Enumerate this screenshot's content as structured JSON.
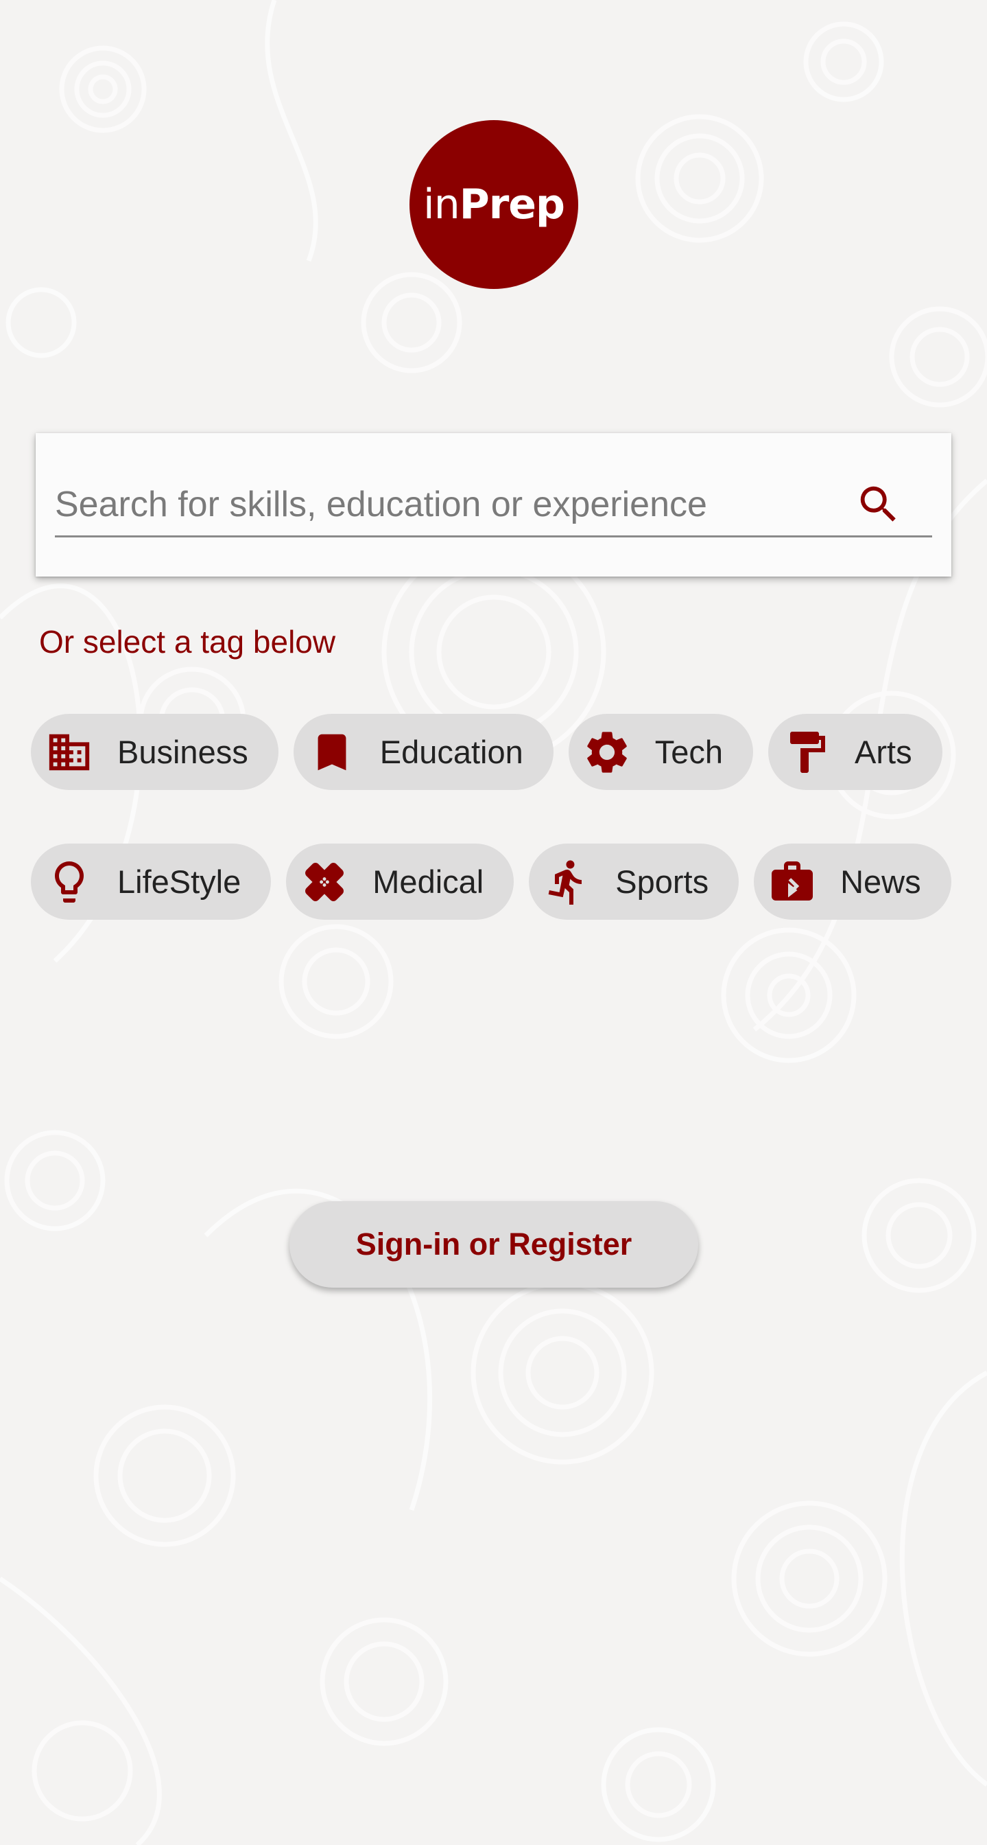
{
  "brand": {
    "logo_text_light": "in",
    "logo_text_bold": "Prep",
    "color": "#8b0000"
  },
  "search": {
    "placeholder": "Search for skills, education or experience",
    "value": "",
    "icon": "search-icon"
  },
  "tag_hint": "Or select a tag below",
  "tags": [
    {
      "label": "Business",
      "icon": "building-icon"
    },
    {
      "label": "Education",
      "icon": "bookmark-icon"
    },
    {
      "label": "Tech",
      "icon": "gear-icon"
    },
    {
      "label": "Arts",
      "icon": "paint-roller-icon"
    },
    {
      "label": "LifeStyle",
      "icon": "lightbulb-icon"
    },
    {
      "label": "Medical",
      "icon": "bandage-icon"
    },
    {
      "label": "Sports",
      "icon": "running-icon"
    },
    {
      "label": "News",
      "icon": "briefcase-icon"
    }
  ],
  "signin_label": "Sign-in or Register",
  "colors": {
    "accent": "#8b0000",
    "chip_background": "#dedddd",
    "page_background": "#f4f3f2"
  }
}
